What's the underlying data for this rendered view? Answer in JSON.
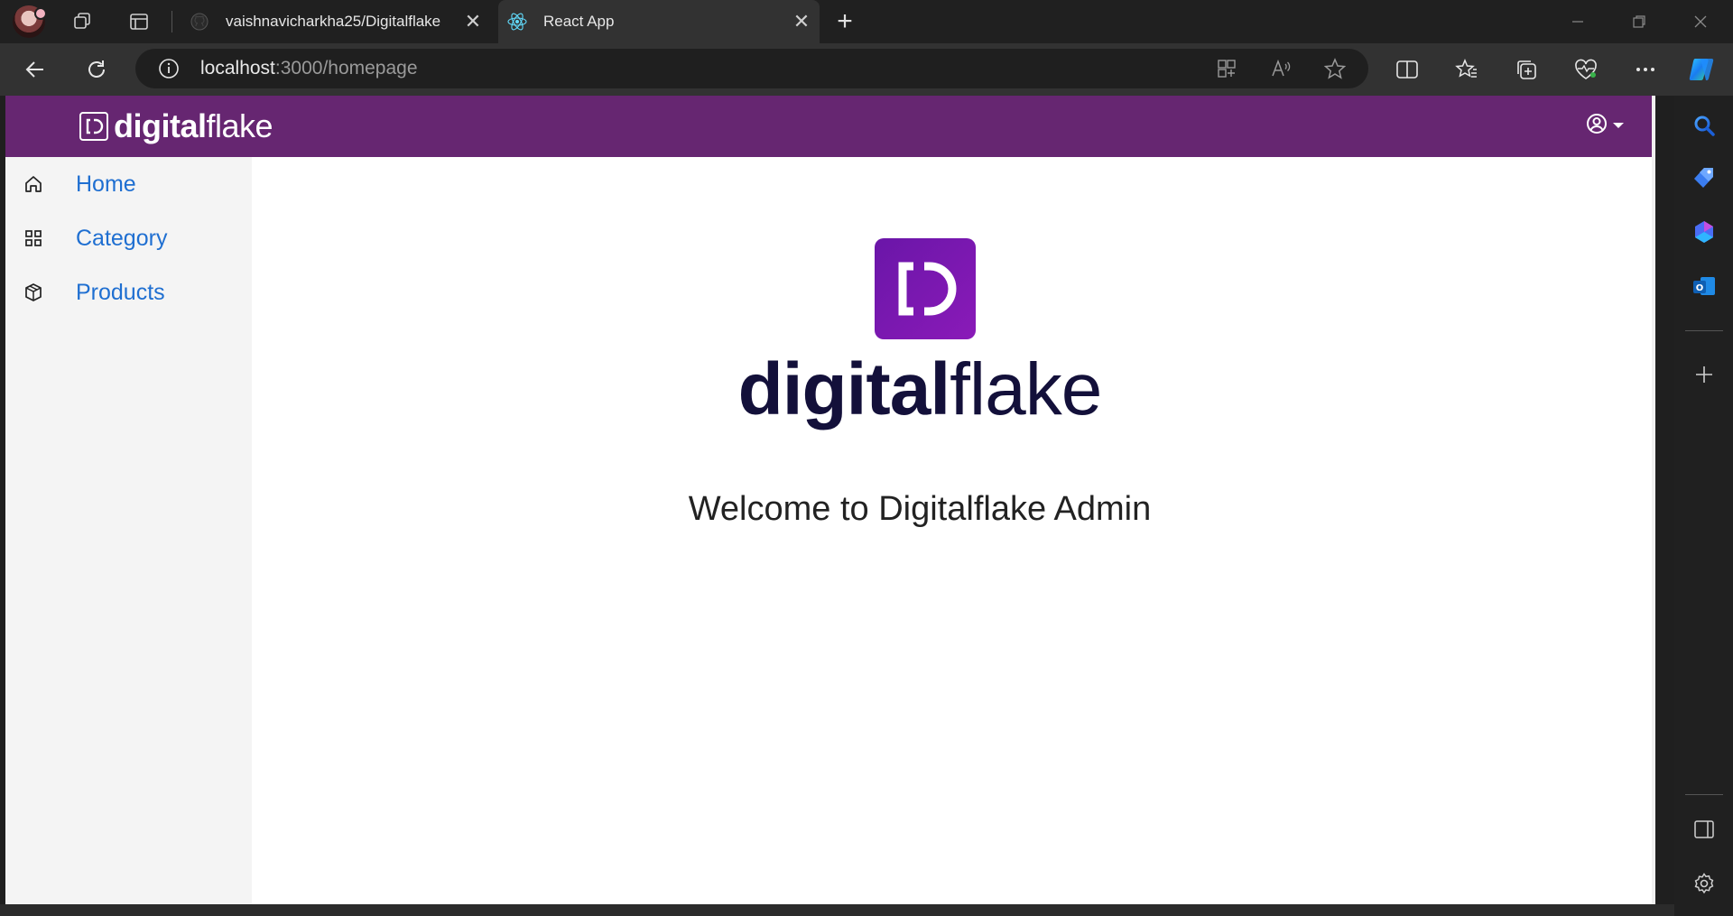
{
  "browser": {
    "tabs": [
      {
        "label": "vaishnavicharkha25/Digitalflake",
        "favicon": "github-icon",
        "active": false
      },
      {
        "label": "React App",
        "favicon": "react-icon",
        "active": true
      }
    ],
    "address": {
      "host": "localhost",
      "path": ":3000/homepage"
    },
    "accent": "#1f1f1f"
  },
  "app": {
    "header": {
      "brand_bold": "digital",
      "brand_light": "flake",
      "color": "#662671",
      "user_menu_icon": "user-circle-icon"
    },
    "sidebar": {
      "items": [
        {
          "label": "Home",
          "icon": "home-icon"
        },
        {
          "label": "Category",
          "icon": "grid-icon"
        },
        {
          "label": "Products",
          "icon": "box-icon"
        }
      ]
    },
    "main": {
      "logo_bold": "digital",
      "logo_light": "flake",
      "welcome": "Welcome to Digitalflake Admin"
    }
  }
}
